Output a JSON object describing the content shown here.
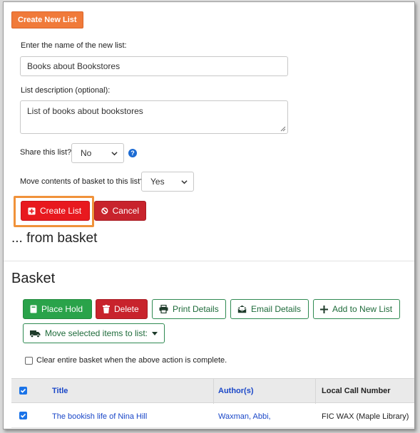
{
  "top": {
    "create_new_list_label": "Create New List"
  },
  "form": {
    "name_label": "Enter the name of the new list:",
    "name_value": "Books about Bookstores",
    "description_label": "List description (optional):",
    "description_value": "List of books about bookstores",
    "share_label": "Share this list?",
    "share_value": "No",
    "move_label": "Move contents of basket to this list?",
    "move_value": "Yes",
    "create_list_label": "Create List",
    "cancel_label": "Cancel"
  },
  "headings": {
    "from_basket": "... from basket",
    "basket": "Basket"
  },
  "actions": {
    "place_hold": "Place Hold",
    "delete": "Delete",
    "print_details": "Print Details",
    "email_details": "Email Details",
    "add_to_new_list": "Add to New List",
    "move_selected": "Move selected items to list:"
  },
  "clear_basket_label": "Clear entire basket when the above action is complete.",
  "table": {
    "headers": {
      "title": "Title",
      "authors": "Author(s)",
      "call_number": "Local Call Number"
    },
    "rows": [
      {
        "title": "The bookish life of Nina Hill",
        "author": "Waxman, Abbi,",
        "call_number": "FIC WAX (Maple Library)",
        "checked": true
      }
    ]
  },
  "colors": {
    "create_new_list_bg": "#f07a3a",
    "create_list_bg": "#e8191f",
    "cancel_bg": "#c8232c",
    "place_hold_bg": "#2aa34a",
    "delete_bg": "#c8232c",
    "outline_green": "#2f8a52",
    "highlight_orange": "#f0923a",
    "link_blue": "#1a47c8"
  },
  "icons": [
    "plus-square-icon",
    "ban-icon",
    "help-icon",
    "book-icon",
    "trash-icon",
    "print-icon",
    "email-icon",
    "plus-icon",
    "truck-icon",
    "chevron-down-icon",
    "checkbox-icon"
  ]
}
